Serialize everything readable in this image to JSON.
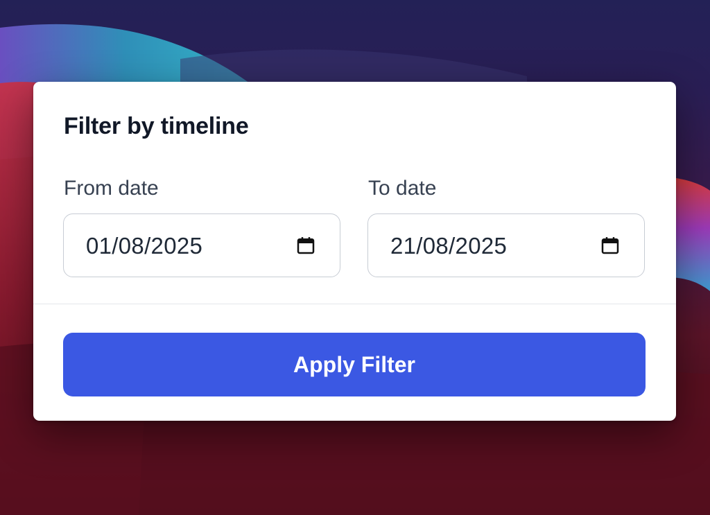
{
  "dialog": {
    "title": "Filter by timeline",
    "from": {
      "label": "From date",
      "value": "01/08/2025",
      "icon": "calendar-icon"
    },
    "to": {
      "label": "To date",
      "value": "21/08/2025",
      "icon": "calendar-icon"
    },
    "apply_label": "Apply Filter"
  },
  "colors": {
    "primary": "#3b58e3",
    "title_text": "#111827",
    "label_text": "#374151",
    "input_border": "#c7ccd4",
    "card_background": "#ffffff"
  }
}
